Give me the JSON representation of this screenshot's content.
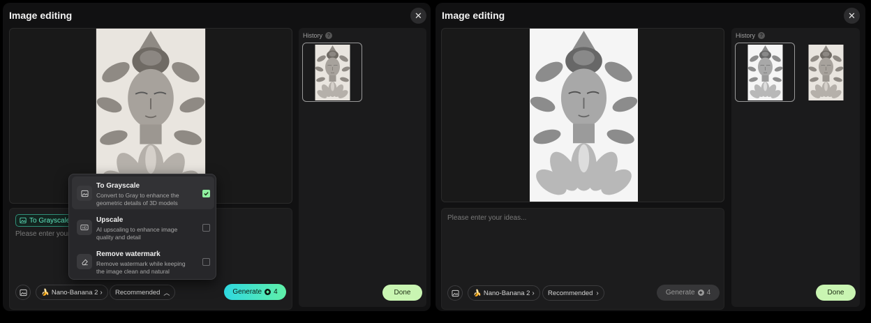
{
  "panels": [
    {
      "title": "Image editing",
      "history_label": "History",
      "tag_label": "To Grayscale",
      "prompt_placeholder": "Please enter your ideas...",
      "model_label": "Nano-Banana 2",
      "preset_label": "Recommended",
      "generate_label": "Generate",
      "generate_cost": "4",
      "done_label": "Done"
    },
    {
      "title": "Image editing",
      "history_label": "History",
      "prompt_placeholder": "Please enter your ideas...",
      "model_label": "Nano-Banana 2",
      "preset_label": "Recommended",
      "generate_label": "Generate",
      "generate_cost": "4",
      "done_label": "Done"
    }
  ],
  "dropdown": {
    "options": [
      {
        "title": "To Grayscale",
        "desc": "Convert to Gray to enhance the geometric details of 3D models",
        "checked": true,
        "icon": "image-icon"
      },
      {
        "title": "Upscale",
        "desc": "AI upscaling to enhance image quality and detail",
        "checked": false,
        "icon": "hd-icon"
      },
      {
        "title": "Remove watermark",
        "desc": "Remove watermark while keeping the image clean and natural",
        "checked": false,
        "icon": "eraser-icon"
      }
    ]
  },
  "icons": {
    "close": "close-icon",
    "help": "help-icon",
    "image": "image-icon",
    "banana": "banana-icon"
  },
  "colors": {
    "accent_start": "#2fd8e0",
    "accent_end": "#5ff0a8",
    "done": "#c9f5b2",
    "panel": "#111112"
  }
}
